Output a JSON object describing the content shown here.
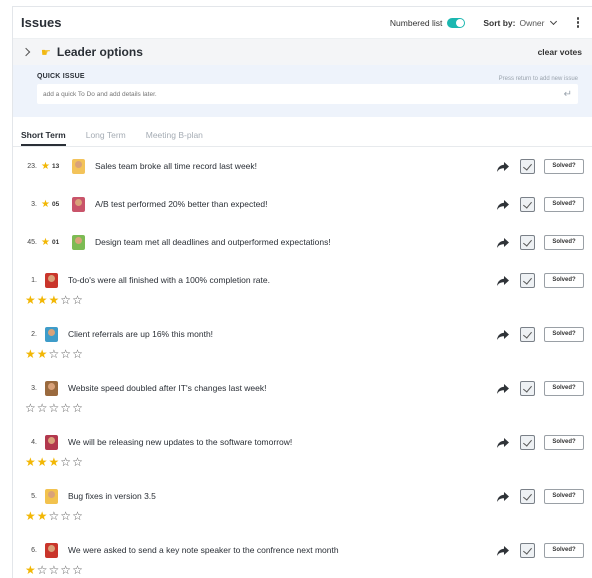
{
  "header": {
    "title": "Issues",
    "numbered_label": "Numbered list",
    "sort_label": "Sort by:",
    "sort_value": "Owner"
  },
  "leader": {
    "title": "Leader options",
    "clear_label": "clear votes"
  },
  "quick": {
    "label": "QUICK ISSUE",
    "hint": "Press return to add new issue",
    "placeholder": "add a quick To Do and add details later."
  },
  "tabs": [
    {
      "label": "Short Term"
    },
    {
      "label": "Long Term"
    },
    {
      "label": "Meeting B-plan"
    }
  ],
  "colors": {
    "accent": "#1bb7b0",
    "star": "#f2b705"
  },
  "solved_label": "Solved?",
  "voted_issues": [
    {
      "num": "23.",
      "votes": "13",
      "text": "Sales team broke all time record last week!",
      "avatar_color": "#f3c35a"
    },
    {
      "num": "3.",
      "votes": "05",
      "text": "A/B test performed 20% better than expected!",
      "avatar_color": "#c9546a"
    },
    {
      "num": "45.",
      "votes": "01",
      "text": "Design team met all deadlines and outperformed expectations!",
      "avatar_color": "#7dbb54"
    }
  ],
  "rated_issues": [
    {
      "num": "1.",
      "text": "To-do's were all finished with a 100% completion rate.",
      "rating": 3,
      "avatar_color": "#c9352b"
    },
    {
      "num": "2.",
      "text": "Client referrals are up 16% this month!",
      "rating": 2,
      "avatar_color": "#3e9cc9"
    },
    {
      "num": "3.",
      "text": "Website speed doubled after IT's changes last week!",
      "rating": 0,
      "avatar_color": "#9a6a3e"
    },
    {
      "num": "4.",
      "text": "We will be releasing new updates to the software tomorrow!",
      "rating": 3,
      "avatar_color": "#b2384e"
    },
    {
      "num": "5.",
      "text": "Bug fixes in version 3.5",
      "rating": 2,
      "avatar_color": "#f2c24e"
    },
    {
      "num": "6.",
      "text": "We were asked to send a key note speaker to the confrence next month",
      "rating": 1,
      "avatar_color": "#c9352b"
    }
  ]
}
